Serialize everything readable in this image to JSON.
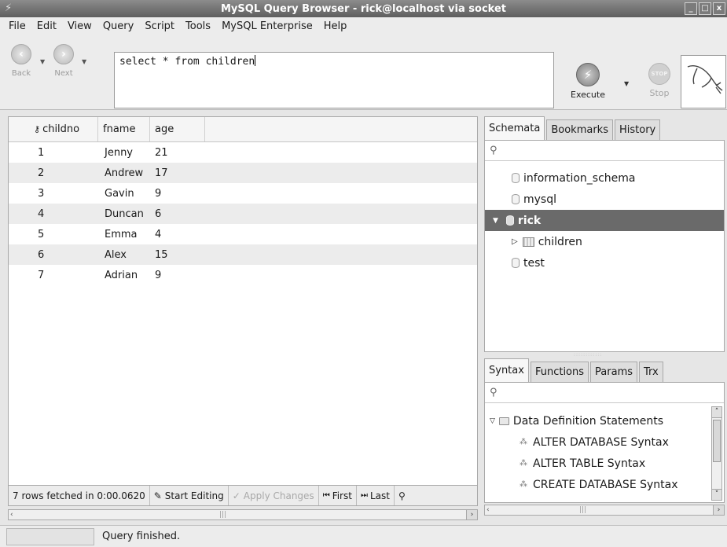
{
  "window": {
    "title": "MySQL Query Browser - rick@localhost via socket",
    "controls": [
      "_",
      "□",
      "x"
    ]
  },
  "menu": [
    "File",
    "Edit",
    "View",
    "Query",
    "Script",
    "Tools",
    "MySQL Enterprise",
    "Help"
  ],
  "toolbar": {
    "back_label": "Back",
    "next_label": "Next",
    "query_text": "select * from children",
    "execute_label": "Execute",
    "stop_label": "Stop",
    "stop_icon_text": "STOP"
  },
  "result": {
    "columns": [
      "childno",
      "fname",
      "age"
    ],
    "rows": [
      [
        "1",
        "Jenny",
        "21"
      ],
      [
        "2",
        "Andrew",
        "17"
      ],
      [
        "3",
        "Gavin",
        "9"
      ],
      [
        "4",
        "Duncan",
        "6"
      ],
      [
        "5",
        "Emma",
        "4"
      ],
      [
        "6",
        "Alex",
        "15"
      ],
      [
        "7",
        "Adrian",
        "9"
      ]
    ],
    "footer": {
      "rows_fetched": "7 rows fetched in 0:00.0620",
      "start_editing": "Start Editing",
      "apply_changes": "Apply Changes",
      "first": "First",
      "last": "Last"
    }
  },
  "schemata_panel": {
    "tabs": [
      "Schemata",
      "Bookmarks",
      "History"
    ],
    "active_tab": "Schemata",
    "items": [
      {
        "label": "information_schema"
      },
      {
        "label": "mysql"
      },
      {
        "label": "rick",
        "selected": true,
        "expanded": true
      },
      {
        "label": "children"
      },
      {
        "label": "test"
      }
    ]
  },
  "syntax_panel": {
    "tabs": [
      "Syntax",
      "Functions",
      "Params",
      "Trx"
    ],
    "active_tab": "Syntax",
    "items": [
      {
        "label": "Data Definition Statements"
      },
      {
        "label": "ALTER DATABASE Syntax"
      },
      {
        "label": "ALTER TABLE Syntax"
      },
      {
        "label": "CREATE DATABASE Syntax"
      }
    ]
  },
  "status": {
    "text": "Query finished."
  }
}
